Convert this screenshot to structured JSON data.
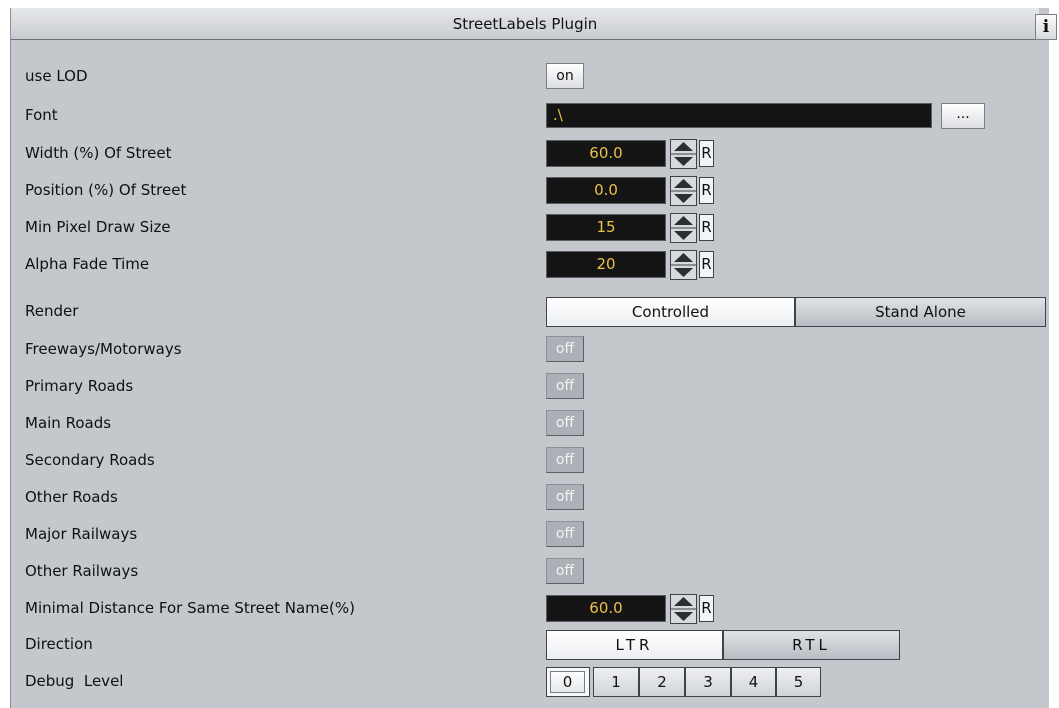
{
  "panel": {
    "title": "StreetLabels Plugin",
    "info_label": "i"
  },
  "rows": {
    "use_lod": {
      "label": "use LOD",
      "value": "on"
    },
    "font": {
      "label": "Font",
      "value": ".\\",
      "browse_label": "..."
    },
    "width_of_street": {
      "label": "Width (%) Of Street",
      "value": "60.0",
      "reset": "R"
    },
    "position_of_street": {
      "label": "Position (%) Of Street",
      "value": "0.0",
      "reset": "R"
    },
    "min_pixel_draw_size": {
      "label": "Min Pixel Draw Size",
      "value": "15",
      "reset": "R"
    },
    "alpha_fade_time": {
      "label": "Alpha Fade Time",
      "value": "20",
      "reset": "R"
    },
    "render": {
      "label": "Render",
      "options": [
        "Controlled",
        "Stand Alone"
      ],
      "selected": "Controlled"
    },
    "freeways": {
      "label": "Freeways/Motorways",
      "value": "off"
    },
    "primary_roads": {
      "label": "Primary Roads",
      "value": "off"
    },
    "main_roads": {
      "label": "Main Roads",
      "value": "off"
    },
    "secondary_roads": {
      "label": "Secondary Roads",
      "value": "off"
    },
    "other_roads": {
      "label": "Other Roads",
      "value": "off"
    },
    "major_railways": {
      "label": "Major Railways",
      "value": "off"
    },
    "other_railways": {
      "label": "Other Railways",
      "value": "off"
    },
    "min_distance": {
      "label": "Minimal Distance For Same Street Name(%)",
      "value": "60.0",
      "reset": "R"
    },
    "direction": {
      "label": "Direction",
      "options": [
        "LTR",
        "RTL"
      ],
      "selected": "LTR"
    },
    "debug_level": {
      "label": "Debug  Level",
      "options": [
        "0",
        "1",
        "2",
        "3",
        "4",
        "5"
      ],
      "selected": "0"
    }
  },
  "colors": {
    "panel_bg": "#c4c7cc",
    "field_bg": "#141414",
    "field_text": "#e9c14a",
    "toggle_off_bg": "#adb1b7"
  }
}
